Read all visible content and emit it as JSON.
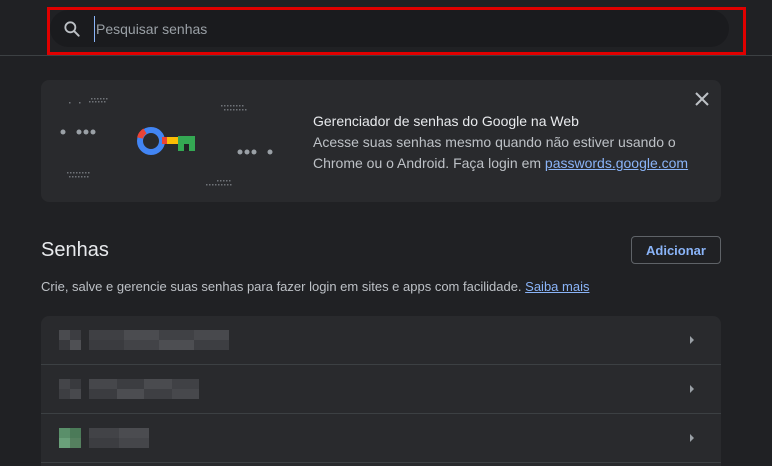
{
  "search": {
    "placeholder": "Pesquisar senhas",
    "value": ""
  },
  "promo": {
    "title": "Gerenciador de senhas do Google na Web",
    "desc_line1": "Acesse suas senhas mesmo quando não estiver usando o",
    "desc_line2_prefix": "Chrome ou o Android. Faça login em ",
    "link": "passwords.google.com"
  },
  "section": {
    "title": "Senhas",
    "add_label": "Adicionar",
    "description": "Crie, salve e gerencie suas senhas para fazer login em sites e apps com facilidade. ",
    "learn_more": "Saiba mais"
  },
  "colors": {
    "background": "#202124",
    "card": "#292a2d",
    "accent": "#8ab4f8",
    "highlight_border": "#e00000"
  }
}
